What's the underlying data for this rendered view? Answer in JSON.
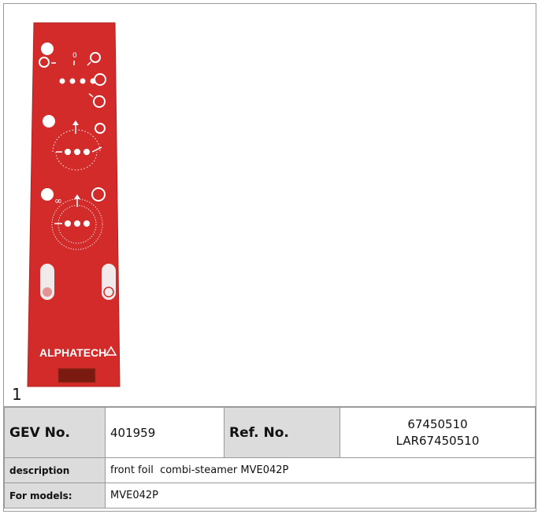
{
  "product_image": {
    "item_number": "1",
    "brand_text": "ALPHATECH",
    "foil_color": "#d32a2a"
  },
  "spec_table": {
    "gev_label": "GEV No.",
    "gev_value": "401959",
    "ref_label": "Ref. No.",
    "ref_values": [
      "67450510",
      "LAR67450510"
    ],
    "description_label": "description",
    "description_value": "front foil  combi-steamer MVE042P",
    "models_label": "For models:",
    "models_value": "MVE042P"
  }
}
